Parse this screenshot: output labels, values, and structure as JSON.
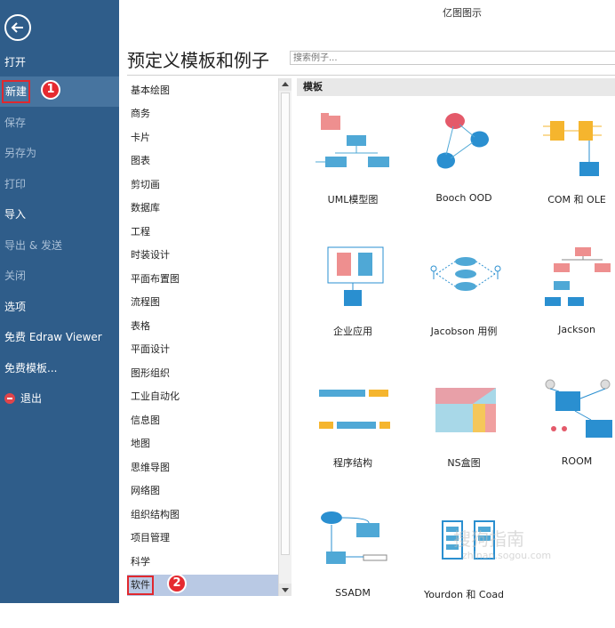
{
  "app_title": "亿图图示",
  "sidebar": {
    "items": [
      {
        "label": "打开"
      },
      {
        "label": "新建",
        "badge": "1"
      },
      {
        "label": "保存"
      },
      {
        "label": "另存为"
      },
      {
        "label": "打印"
      },
      {
        "label": "导入"
      },
      {
        "label": "导出 & 发送"
      },
      {
        "label": "关闭"
      },
      {
        "label": "选项"
      },
      {
        "label": "免费 Edraw Viewer"
      },
      {
        "label": "免费模板..."
      },
      {
        "label": "退出"
      }
    ]
  },
  "main": {
    "title": "预定义模板和例子",
    "search_placeholder": "搜索例子...",
    "categories": [
      {
        "label": "基本绘图"
      },
      {
        "label": "商务"
      },
      {
        "label": "卡片"
      },
      {
        "label": "图表"
      },
      {
        "label": "剪切画"
      },
      {
        "label": "数据库"
      },
      {
        "label": "工程"
      },
      {
        "label": "时装设计"
      },
      {
        "label": "平面布置图"
      },
      {
        "label": "流程图"
      },
      {
        "label": "表格"
      },
      {
        "label": "平面设计"
      },
      {
        "label": "图形组织"
      },
      {
        "label": "工业自动化"
      },
      {
        "label": "信息图"
      },
      {
        "label": "地图"
      },
      {
        "label": "思维导图"
      },
      {
        "label": "网络图"
      },
      {
        "label": "组织结构图"
      },
      {
        "label": "项目管理"
      },
      {
        "label": "科学"
      },
      {
        "label": "软件",
        "badge": "2"
      }
    ],
    "templates_header": "模板",
    "templates": [
      {
        "label": "UML模型图",
        "icon": "uml-diagram-icon"
      },
      {
        "label": "Booch OOD",
        "icon": "booch-ood-icon"
      },
      {
        "label": "COM 和 OLE",
        "icon": "com-ole-icon"
      },
      {
        "label": "企业应用",
        "icon": "enterprise-app-icon"
      },
      {
        "label": "Jacobson 用例",
        "icon": "jacobson-usecase-icon"
      },
      {
        "label": "Jackson",
        "icon": "jackson-icon"
      },
      {
        "label": "程序结构",
        "icon": "program-structure-icon"
      },
      {
        "label": "NS盒图",
        "icon": "ns-box-icon"
      },
      {
        "label": "ROOM",
        "icon": "room-icon"
      },
      {
        "label": "SSADM",
        "icon": "ssadm-icon"
      },
      {
        "label": "Yourdon 和 Coad",
        "icon": "yourdon-coad-icon"
      }
    ]
  },
  "watermark": {
    "text": "搜狗指南",
    "sub": "zhinan.sogou.com"
  },
  "colors": {
    "sidebar": "#2f5d8a",
    "sidebar_selected": "#47749f",
    "accent_red": "#e52a30",
    "list_selected": "#b9c9e4"
  }
}
